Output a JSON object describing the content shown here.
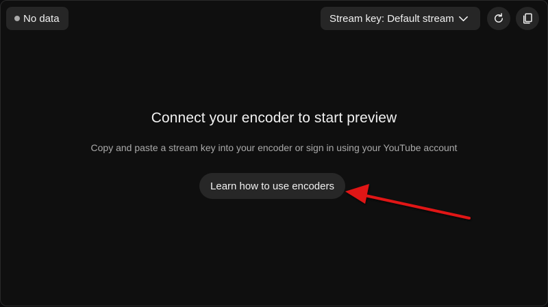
{
  "status": {
    "label": "No data",
    "dot_color": "#aaaaaa"
  },
  "stream_key": {
    "label": "Stream key: Default stream",
    "icon": "chevron-down-icon"
  },
  "toolbar": {
    "refresh_icon": "refresh-icon",
    "copy_icon": "copy-icon"
  },
  "main": {
    "title": "Connect your encoder to start preview",
    "description": "Copy and paste a stream key into your encoder or sign in using your YouTube account",
    "learn_button_label": "Learn how to use encoders"
  },
  "annotation": {
    "arrow_color": "#e01414"
  },
  "colors": {
    "background": "#0f0f0f",
    "surface": "#262626",
    "text_primary": "#f1f1f1",
    "text_secondary": "#aaaaaa"
  }
}
